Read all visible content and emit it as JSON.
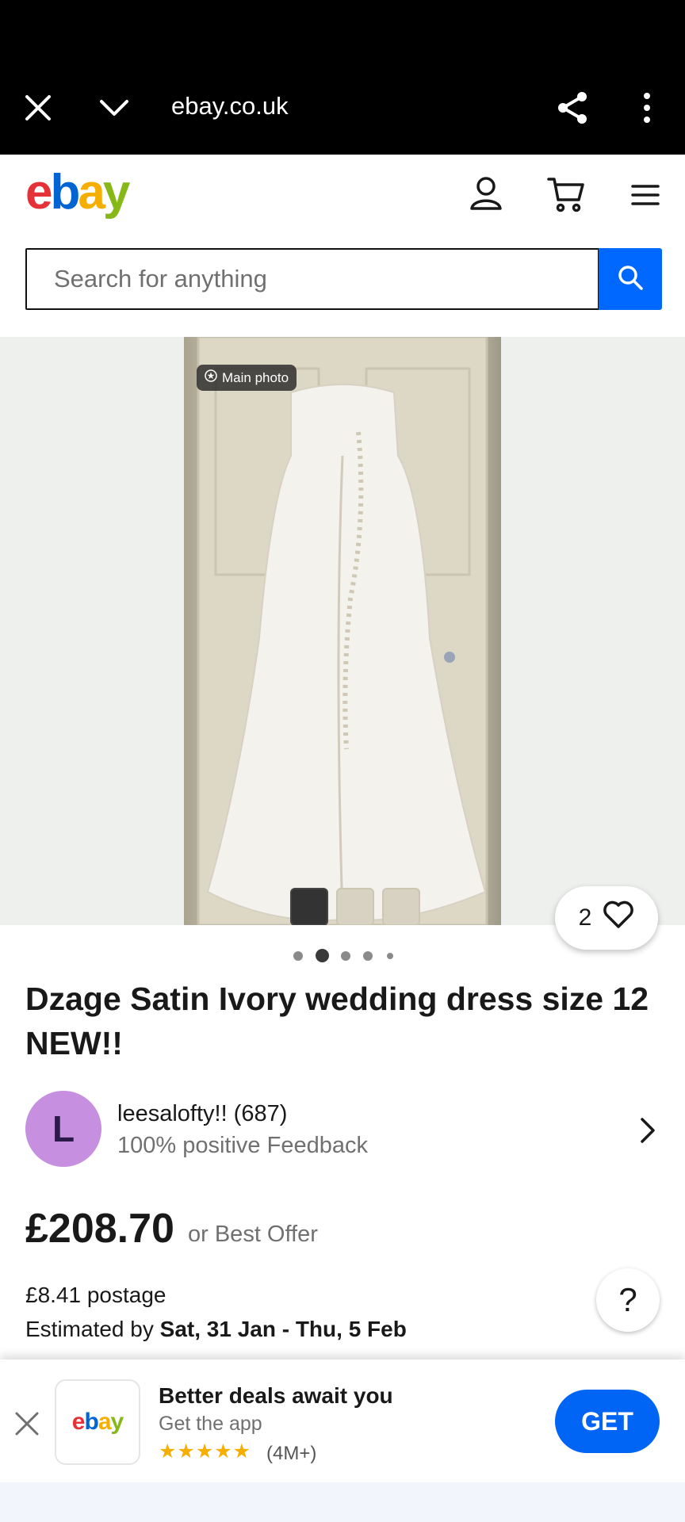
{
  "browser": {
    "url": "ebay.co.uk"
  },
  "search": {
    "placeholder": "Search for anything"
  },
  "gallery": {
    "badge": "Main photo",
    "watch_count": "2",
    "active_dot": 2,
    "dot_count": 5
  },
  "listing": {
    "title": "Dzage Satin Ivory wedding dress size 12 NEW!!"
  },
  "seller": {
    "initial": "L",
    "name": "leesalofty!! (687)",
    "feedback": "100% positive Feedback"
  },
  "pricing": {
    "price": "£208.70",
    "offer_text": "or Best Offer",
    "postage": "£8.41 postage",
    "estimated_prefix": "Estimated by ",
    "estimated_dates": "Sat, 31 Jan - Thu, 5 Feb"
  },
  "help": {
    "label": "?"
  },
  "app_banner": {
    "title": "Better deals await you",
    "subtitle": "Get the app",
    "stars": "★★★★★",
    "rating": "(4M+)",
    "get_label": "GET"
  },
  "colors": {
    "brand_blue": "#0064d2",
    "button_blue": "#0068ff",
    "ebay_red": "#e53238",
    "ebay_yellow": "#f5af02",
    "ebay_green": "#86b817"
  }
}
